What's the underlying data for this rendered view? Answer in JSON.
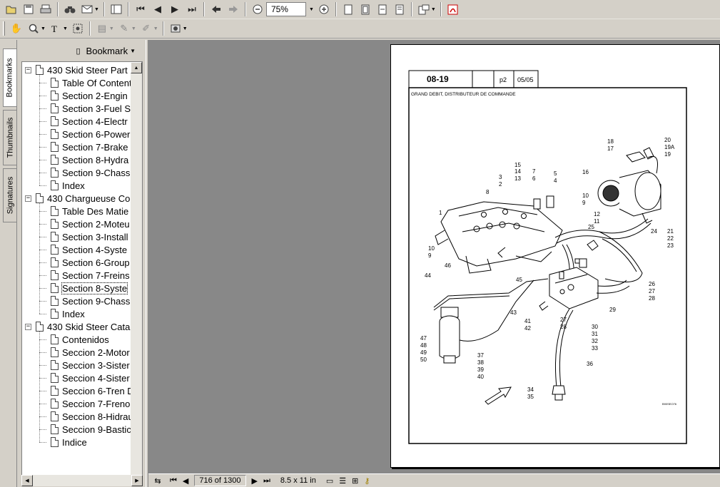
{
  "toolbar": {
    "zoom_value": "75%"
  },
  "side_tabs": [
    "Bookmarks",
    "Thumbnails",
    "Signatures"
  ],
  "bookmarks": {
    "header_label": "Bookmark",
    "groups": [
      {
        "title": "430 Skid Steer Part",
        "items": [
          "Table Of Content",
          "Section 2-Engin",
          "Section 3-Fuel S",
          "Section 4-Electr",
          "Section 6-Power",
          "Section 7-Brake",
          "Section 8-Hydra",
          "Section 9-Chass",
          "Index"
        ]
      },
      {
        "title": "430 Chargueuse Co",
        "items": [
          "Table Des Matie",
          "Section 2-Moteu",
          "Section 3-Install",
          "Section 4-Syste",
          "Section 6-Group",
          "Section 7-Freins",
          "Section 8-Syste",
          "Section 9-Chass",
          "Index"
        ]
      },
      {
        "title": "430 Skid Steer Cata",
        "items": [
          "Contenidos",
          "Seccion 2-Motor",
          "Seccion 3-Sister",
          "Seccion 4-Sister",
          "Seccion 6-Tren D",
          "Seccion 7-Freno",
          "Seccion 8-Hidrau",
          "Seccion 9-Bastic",
          "Indice"
        ]
      }
    ]
  },
  "status": {
    "page_display": "716 of 1300",
    "page_size": "8.5 x 11 in"
  },
  "document": {
    "header_code": "08-19",
    "header_page": "p2",
    "header_date": "05/05",
    "caption": "GRAND DEBIT, DISTRIBUTEUR DE COMMANDE",
    "figure_id": "B90SEO76",
    "callouts": [
      "18",
      "17",
      "20",
      "19A",
      "19",
      "16",
      "15",
      "14",
      "13",
      "7",
      "6",
      "5",
      "4",
      "3",
      "2",
      "8",
      "10",
      "9",
      "1",
      "12",
      "11",
      "25",
      "24",
      "21",
      "22",
      "23",
      "10",
      "9",
      "46",
      "45",
      "44",
      "26",
      "27",
      "28",
      "43",
      "29",
      "41",
      "42",
      "27",
      "28",
      "30",
      "31",
      "32",
      "33",
      "47",
      "48",
      "49",
      "50",
      "37",
      "38",
      "39",
      "40",
      "36",
      "34",
      "35"
    ]
  }
}
